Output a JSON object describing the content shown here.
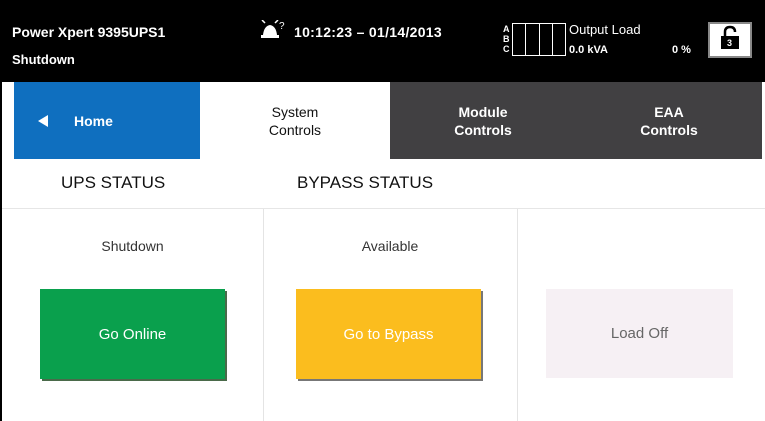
{
  "header": {
    "title": "Power Xpert 9395UPS1",
    "subtitle": "Shutdown",
    "alarm_badge": "?",
    "datetime": "10:12:23 – 01/14/2013",
    "phases": [
      "A",
      "B",
      "C"
    ],
    "output_label": "Output Load",
    "output_kva": "0.0 kVA",
    "output_percent": "0 %",
    "lock_icon": "unlocked-padlock-icon",
    "lock_level": "3"
  },
  "tabs": {
    "home": "Home",
    "system_controls": "System\nControls",
    "module_controls": "Module\nControls",
    "eaa_controls": "EAA\nControls"
  },
  "status": {
    "ups_heading": "UPS STATUS",
    "bypass_heading": "BYPASS STATUS"
  },
  "columns": {
    "ups_state": "Shutdown",
    "bypass_state": "Available"
  },
  "buttons": {
    "go_online": "Go Online",
    "go_to_bypass": "Go to Bypass",
    "load_off": "Load Off"
  },
  "colors": {
    "home_tab": "#0f6fbf",
    "dark_tab": "#414042",
    "go_online": "#0aa04d",
    "go_to_bypass": "#fbbd1e",
    "load_off_disabled": "#f6f0f4"
  }
}
